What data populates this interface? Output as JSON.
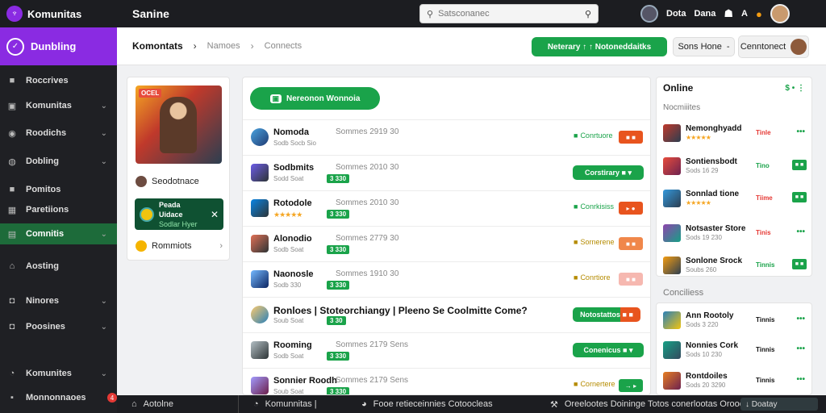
{
  "app": {
    "brand": "Komunitas",
    "top_title": "Sanine",
    "search_placeholder": "Satsconanec",
    "user_name": "Dota",
    "user_tag": "Dana",
    "top_icon_a": "A"
  },
  "sidebar": {
    "header": "Dunbling",
    "items": [
      {
        "label": "Roccrives",
        "icon": "square-icon",
        "chevron": false
      },
      {
        "label": "Komunitas",
        "icon": "bag-icon",
        "chevron": true
      },
      {
        "label": "Roodichs",
        "icon": "compass-icon",
        "chevron": true
      },
      {
        "label": "Dobling",
        "icon": "controller-icon",
        "chevron": true
      },
      {
        "label": "Pomitos",
        "icon": "square-icon",
        "chevron": false
      },
      {
        "label": "Paretiions",
        "icon": "grid-icon",
        "chevron": false
      },
      {
        "label": "Comnitis",
        "icon": "card-icon",
        "chevron": true,
        "active": true
      },
      {
        "label": "Aosting",
        "icon": "home-icon",
        "chevron": false
      },
      {
        "label": "Ninores",
        "icon": "gamepad-icon",
        "chevron": true
      },
      {
        "label": "Poosines",
        "icon": "gamepad-icon",
        "chevron": true
      },
      {
        "label": "Komunites",
        "icon": "globe-icon",
        "chevron": true
      },
      {
        "label": "Monnonnaoes",
        "icon": "flag-icon",
        "chevron": false,
        "badge": "4"
      }
    ]
  },
  "crumbs": {
    "main": "Komontats",
    "sep": "›",
    "items": [
      "Namoes",
      "Connects"
    ],
    "primary_button": "Neterary ↑ ↑ Notoneddaitks",
    "button_two": "Sons Hone",
    "button_three": "Cenntonect"
  },
  "left_panel": {
    "art_tag": "OCEL",
    "user_label": "Seodotnace",
    "card_title": "Peada Uidace",
    "card_sub": "Sodlar Hyer",
    "bottom_label": "Rommiots"
  },
  "center": {
    "top_button": "Nereonon Wonnoia",
    "rows": [
      {
        "name": "Nomoda",
        "sub": "Sodb Socb Sio",
        "meta": "Sommes 2919 30",
        "pill": "",
        "status": "Conrtuore",
        "status_color": "#1aa34a",
        "sq": "■ ■",
        "sq_color": "#e8541e",
        "action": ""
      },
      {
        "name": "Sodbmits",
        "sub": "Sodd Soat",
        "meta": "Sommes 2010 30",
        "pill": "3 330",
        "status": "",
        "status_color": "",
        "sq": "",
        "sq_color": "",
        "action": "Corstirary ■ ▾"
      },
      {
        "name": "Rotodole",
        "sub": "★★★★★",
        "meta": "Sommes 2010 30",
        "pill": "3 330",
        "status": "Conrkisiss",
        "status_color": "#1aa34a",
        "sq": "▸ ●",
        "sq_color": "#e8541e",
        "action": ""
      },
      {
        "name": "Alonodio",
        "sub": "Sodb Soat",
        "meta": "Sommes 2779 30",
        "pill": "3 330",
        "status": "Sornerene",
        "status_color": "#b58b00",
        "sq": "■ ■",
        "sq_color": "#f0874a",
        "action": ""
      },
      {
        "name": "Naonosle",
        "sub": "Sodb 330",
        "meta": "Sommes 1910 30",
        "pill": "3 330",
        "status": "Conrtiore",
        "status_color": "#b58b00",
        "sq": "■ ■",
        "sq_color": "#f6b8b0",
        "action": ""
      },
      {
        "name": "Ronloes | Stoteorchiangy | Pleeno Se Coolmitte Come?",
        "sub": "Soub Soat",
        "meta": "",
        "pill": "3 30",
        "status": "",
        "status_color": "",
        "sq": "",
        "sq_color": "",
        "action": "Notostattos ■ ■"
      },
      {
        "name": "Rooming",
        "sub": "Sodb Soat",
        "meta": "Sommes 2179 Sens",
        "pill": "3 330",
        "status": "",
        "status_color": "",
        "sq": "",
        "sq_color": "",
        "action": "Conenicus ■ ▾"
      },
      {
        "name": "Sonnier Roodh",
        "sub": "Soub Soat",
        "meta": "Sommes 2179 Sens",
        "pill": "3 330",
        "status": "Cornertere",
        "status_color": "#b58b00",
        "sq": "→ ▸",
        "sq_color": "#1aa34a",
        "action": ""
      }
    ]
  },
  "right": {
    "title": "Online",
    "title_icons": "$ • ⋮",
    "sub1": "Nocmiiites",
    "online": [
      {
        "name": "Nemonghyadd",
        "sub": "★★★★★",
        "val": "Tinle",
        "val_color": "#e53935",
        "end": "•••",
        "box": false
      },
      {
        "name": "Sontiensbodt",
        "sub": "Sods 16 29",
        "val": "Tino",
        "val_color": "#1aa34a",
        "end": "■ ■",
        "box": true
      },
      {
        "name": "Sonnlad tione",
        "sub": "★★★★★",
        "val": "Tiime",
        "val_color": "#e53935",
        "end": "■ ■",
        "box": true
      },
      {
        "name": "Notsaster Store",
        "sub": "Sods 19 230",
        "val": "Tinis",
        "val_color": "#e53935",
        "end": "•••",
        "box": false
      },
      {
        "name": "Sonlone Srock",
        "sub": "Soubs 260",
        "val": "Tinnis",
        "val_color": "#1aa34a",
        "end": "■ ■",
        "box": true
      }
    ],
    "sub2": "Conciliess",
    "second": [
      {
        "name": "Ann Rootoly",
        "sub": "Sods 3 220",
        "val": "Tinnis",
        "val_color": "#111",
        "end": "•••",
        "box": false
      },
      {
        "name": "Nonnies Cork",
        "sub": "Sods 10 230",
        "val": "Tinnis",
        "val_color": "#111",
        "end": "•••",
        "box": false
      },
      {
        "name": "Rontdoiles",
        "sub": "Sods 20 3290",
        "val": "Tinnis",
        "val_color": "#111",
        "end": "•••",
        "box": false
      }
    ]
  },
  "bottom": {
    "item1": "Aotolne",
    "item2": "Komunnitas |",
    "item3": "Fooe retieceinnies Cotoocleas",
    "item4": "Oreelootes Doininge Totos conerlootas Orooets",
    "end": "↓ Doatay"
  }
}
